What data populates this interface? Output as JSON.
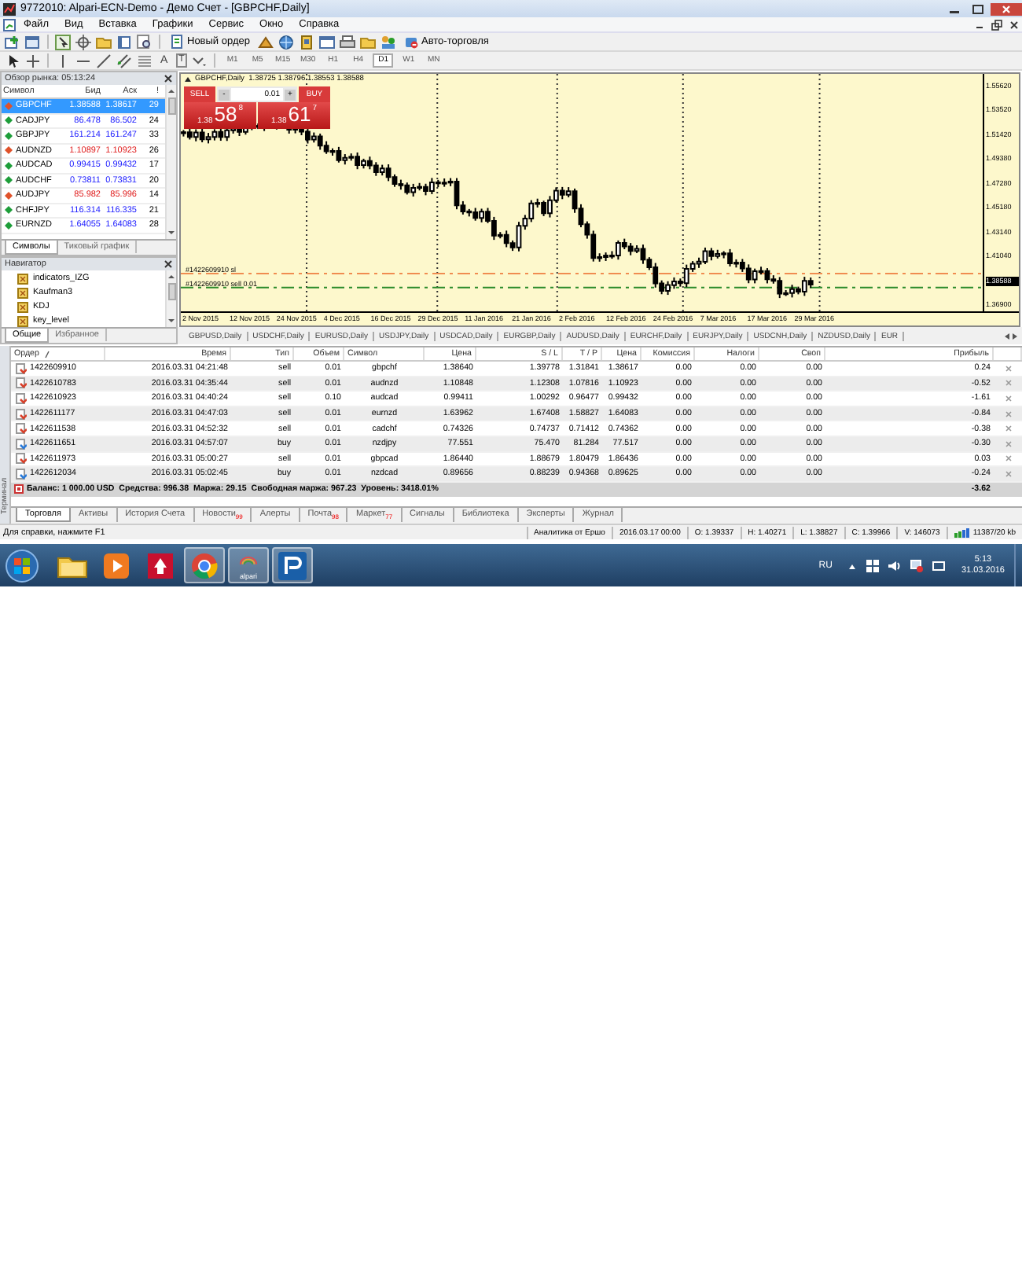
{
  "window": {
    "title": "9772010: Alpari-ECN-Demo - Демо Счет - [GBPCHF,Daily]"
  },
  "menu": [
    "Файл",
    "Вид",
    "Вставка",
    "Графики",
    "Сервис",
    "Окно",
    "Справка"
  ],
  "toolbar": {
    "new_order": "Новый ордер",
    "auto_trading": "Авто-торговля",
    "text_tool": "A",
    "label_tool": "T"
  },
  "timeframes": [
    {
      "label": "M1",
      "selected": false
    },
    {
      "label": "M5",
      "selected": false
    },
    {
      "label": "M15",
      "selected": false
    },
    {
      "label": "M30",
      "selected": false
    },
    {
      "label": "H1",
      "selected": false
    },
    {
      "label": "H4",
      "selected": false
    },
    {
      "label": "D1",
      "selected": true
    },
    {
      "label": "W1",
      "selected": false
    },
    {
      "label": "MN",
      "selected": false
    }
  ],
  "market_watch": {
    "title": "Обзор рынка: 05:13:24",
    "columns": [
      "Символ",
      "Бид",
      "Аск",
      "!"
    ],
    "rows": [
      {
        "symbol": "GBPCHF",
        "bid": "1.38588",
        "ask": "1.38617",
        "spread": "29",
        "rising": false,
        "selected": true
      },
      {
        "symbol": "CADJPY",
        "bid": "86.478",
        "ask": "86.502",
        "spread": "24",
        "rising": true,
        "selected": false
      },
      {
        "symbol": "GBPJPY",
        "bid": "161.214",
        "ask": "161.247",
        "spread": "33",
        "rising": true,
        "selected": false
      },
      {
        "symbol": "AUDNZD",
        "bid": "1.10897",
        "ask": "1.10923",
        "spread": "26",
        "rising": false,
        "selected": false
      },
      {
        "symbol": "AUDCAD",
        "bid": "0.99415",
        "ask": "0.99432",
        "spread": "17",
        "rising": true,
        "selected": false
      },
      {
        "symbol": "AUDCHF",
        "bid": "0.73811",
        "ask": "0.73831",
        "spread": "20",
        "rising": true,
        "selected": false
      },
      {
        "symbol": "AUDJPY",
        "bid": "85.982",
        "ask": "85.996",
        "spread": "14",
        "rising": false,
        "selected": false
      },
      {
        "symbol": "CHFJPY",
        "bid": "116.314",
        "ask": "116.335",
        "spread": "21",
        "rising": true,
        "selected": false
      },
      {
        "symbol": "EURNZD",
        "bid": "1.64055",
        "ask": "1.64083",
        "spread": "28",
        "rising": true,
        "selected": false
      }
    ],
    "tabs": [
      {
        "label": "Символы",
        "selected": true
      },
      {
        "label": "Тиковый график",
        "selected": false
      }
    ]
  },
  "navigator": {
    "title": "Навигатор",
    "items": [
      "indicators_IZG",
      "Kaufman3",
      "KDJ",
      "key_level"
    ],
    "tabs": [
      {
        "label": "Общие",
        "selected": true
      },
      {
        "label": "Избранное",
        "selected": false
      }
    ]
  },
  "chart": {
    "header": "GBPCHF,Daily  1.38725 1.38796 1.38553 1.38588",
    "trade_panel": {
      "sell": "SELL",
      "buy": "BUY",
      "lot": "0.01",
      "lot_down": "-",
      "lot_up": "+",
      "bid": {
        "prefix": "1.38",
        "main": "58",
        "suffix": "8"
      },
      "ask": {
        "prefix": "1.38",
        "main": "61",
        "suffix": "7"
      }
    },
    "lines": [
      {
        "label": "#1422609910 sl",
        "kind": "stop_loss"
      },
      {
        "label": "#1422609910 sell 0.01",
        "kind": "order"
      }
    ],
    "price_axis": [
      {
        "label": "1.55620",
        "current": false
      },
      {
        "label": "1.53520",
        "current": false
      },
      {
        "label": "1.51420",
        "current": false
      },
      {
        "label": "1.49380",
        "current": false
      },
      {
        "label": "1.47280",
        "current": false
      },
      {
        "label": "1.45180",
        "current": false
      },
      {
        "label": "1.43140",
        "current": false
      },
      {
        "label": "1.41040",
        "current": false
      },
      {
        "label": "1.38588",
        "current": true
      },
      {
        "label": "1.36900",
        "current": false
      }
    ],
    "date_axis": [
      "2 Nov 2015",
      "12 Nov 2015",
      "24 Nov 2015",
      "4 Dec 2015",
      "16 Dec 2015",
      "29 Dec 2015",
      "11 Jan 2016",
      "21 Jan 2016",
      "2 Feb 2016",
      "12 Feb 2016",
      "24 Feb 2016",
      "7 Mar 2016",
      "17 Mar 2016",
      "29 Mar 2016"
    ],
    "tabs": [
      "GBPUSD,Daily",
      "USDCHF,Daily",
      "EURUSD,Daily",
      "USDJPY,Daily",
      "USDCAD,Daily",
      "EURGBP,Daily",
      "AUDUSD,Daily",
      "EURCHF,Daily",
      "EURJPY,Daily",
      "USDCNH,Daily",
      "NZDUSD,Daily",
      "EUR"
    ]
  },
  "terminal": {
    "side_label": "Терминал",
    "columns": [
      "Ордер",
      "Время",
      "Тип",
      "Объем",
      "Символ",
      "Цена",
      "S / L",
      "T / P",
      "Цена",
      "Комиссия",
      "Налоги",
      "Своп",
      "Прибыль"
    ],
    "rows": [
      {
        "kind": "sell",
        "cells": [
          "1422609910",
          "2016.03.31 04:21:48",
          "sell",
          "0.01",
          "gbpchf",
          "1.38640",
          "1.39778",
          "1.31841",
          "1.38617",
          "0.00",
          "0.00",
          "0.00",
          "0.24"
        ]
      },
      {
        "kind": "sell",
        "cells": [
          "1422610783",
          "2016.03.31 04:35:44",
          "sell",
          "0.01",
          "audnzd",
          "1.10848",
          "1.12308",
          "1.07816",
          "1.10923",
          "0.00",
          "0.00",
          "0.00",
          "-0.52"
        ]
      },
      {
        "kind": "sell",
        "cells": [
          "1422610923",
          "2016.03.31 04:40:24",
          "sell",
          "0.10",
          "audcad",
          "0.99411",
          "1.00292",
          "0.96477",
          "0.99432",
          "0.00",
          "0.00",
          "0.00",
          "-1.61"
        ]
      },
      {
        "kind": "sell",
        "cells": [
          "1422611177",
          "2016.03.31 04:47:03",
          "sell",
          "0.01",
          "eurnzd",
          "1.63962",
          "1.67408",
          "1.58827",
          "1.64083",
          "0.00",
          "0.00",
          "0.00",
          "-0.84"
        ]
      },
      {
        "kind": "sell",
        "cells": [
          "1422611538",
          "2016.03.31 04:52:32",
          "sell",
          "0.01",
          "cadchf",
          "0.74326",
          "0.74737",
          "0.71412",
          "0.74362",
          "0.00",
          "0.00",
          "0.00",
          "-0.38"
        ]
      },
      {
        "kind": "buy",
        "cells": [
          "1422611651",
          "2016.03.31 04:57:07",
          "buy",
          "0.01",
          "nzdjpy",
          "77.551",
          "75.470",
          "81.284",
          "77.517",
          "0.00",
          "0.00",
          "0.00",
          "-0.30"
        ]
      },
      {
        "kind": "sell",
        "cells": [
          "1422611973",
          "2016.03.31 05:00:27",
          "sell",
          "0.01",
          "gbpcad",
          "1.86440",
          "1.88679",
          "1.80479",
          "1.86436",
          "0.00",
          "0.00",
          "0.00",
          "0.03"
        ]
      },
      {
        "kind": "buy",
        "cells": [
          "1422612034",
          "2016.03.31 05:02:45",
          "buy",
          "0.01",
          "nzdcad",
          "0.89656",
          "0.88239",
          "0.94368",
          "0.89625",
          "0.00",
          "0.00",
          "0.00",
          "-0.24"
        ]
      }
    ],
    "summary": "Баланс: 1 000.00 USD  Средства: 996.38  Маржа: 29.15  Свободная маржа: 967.23  Уровень: 3418.01%",
    "total": "-3.62",
    "tabs": [
      {
        "label": "Торговля",
        "selected": true
      },
      {
        "label": "Активы",
        "selected": false
      },
      {
        "label": "История Счета",
        "selected": false
      },
      {
        "label": "Новости",
        "badge": "99",
        "selected": false
      },
      {
        "label": "Алерты",
        "selected": false
      },
      {
        "label": "Почта",
        "badge": "98",
        "selected": false
      },
      {
        "label": "Маркет",
        "badge": "77",
        "selected": false
      },
      {
        "label": "Сигналы",
        "selected": false
      },
      {
        "label": "Библиотека",
        "selected": false
      },
      {
        "label": "Эксперты",
        "selected": false
      },
      {
        "label": "Журнал",
        "selected": false
      }
    ]
  },
  "status_bar": {
    "help": "Для справки, нажмите F1",
    "fields": [
      "Аналитика от Ершо",
      "2016.03.17 00:00",
      "O: 1.39337",
      "H: 1.40271",
      "L: 1.38827",
      "C: 1.39966",
      "V: 146073"
    ],
    "traffic": "11387/20 kb"
  },
  "taskbar": {
    "apps": [
      {
        "kind": "folder",
        "active": false
      },
      {
        "kind": "media",
        "active": false
      },
      {
        "kind": "game",
        "active": false
      },
      {
        "kind": "browser",
        "active": true
      },
      {
        "kind": "alpari",
        "label": "alpari",
        "active": true
      },
      {
        "kind": "terminal",
        "active": true
      }
    ],
    "language": "RU",
    "time": "5:13",
    "date": "31.03.2016"
  }
}
